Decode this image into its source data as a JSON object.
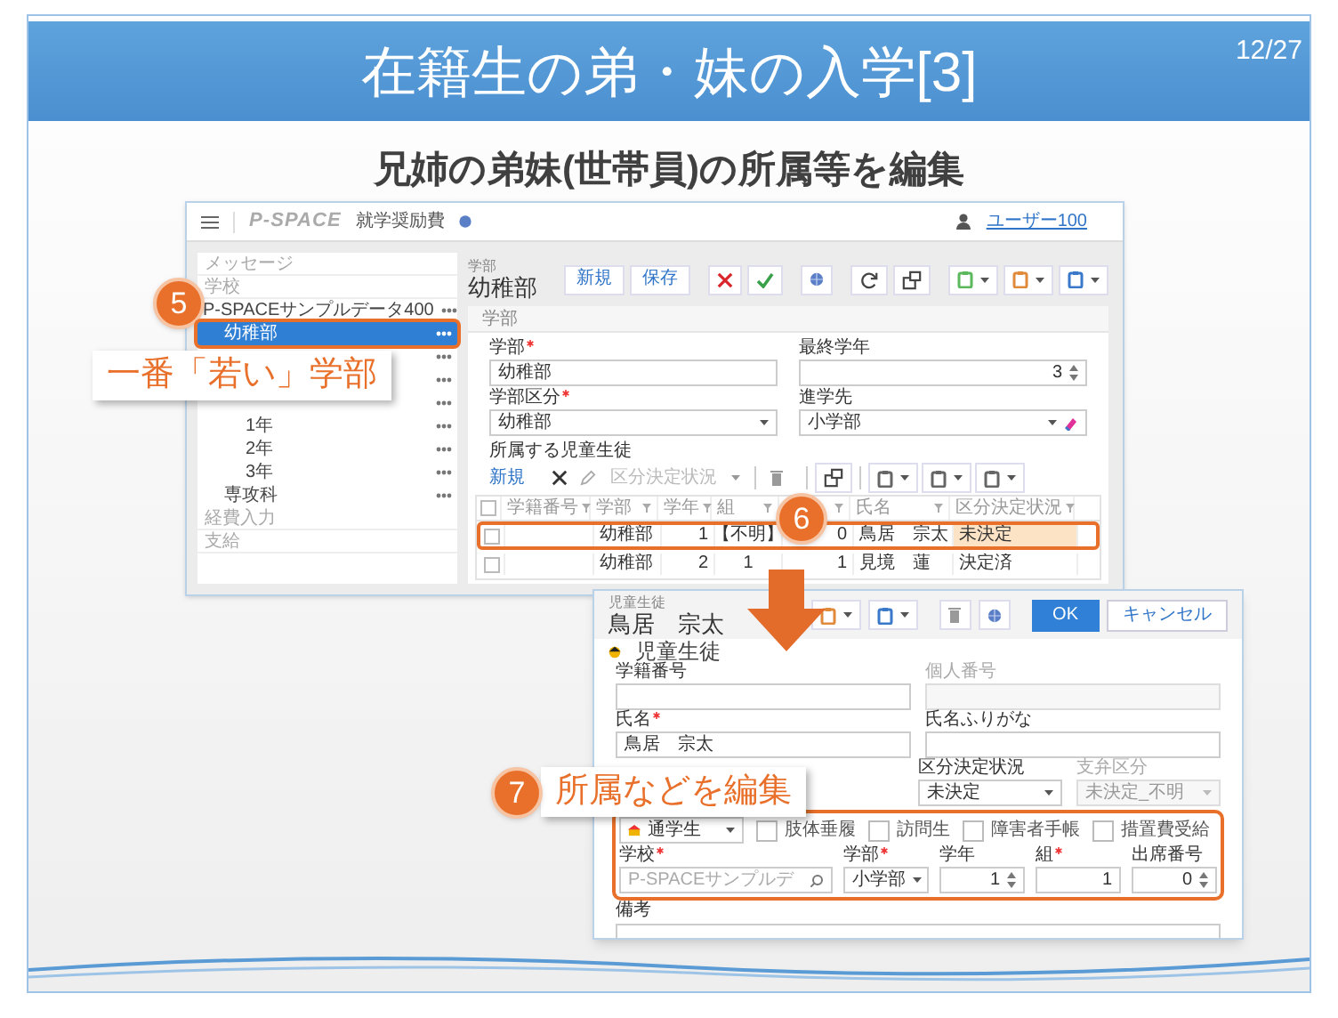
{
  "slide": {
    "title": "在籍生の弟・妹の入学[3]",
    "page": "12/27",
    "subtitle": "兄姉の弟妹(世帯員)の所属等を編集"
  },
  "school_screen": {
    "logo": "P-SPACE",
    "app_name": "就学奨励費",
    "user": "ユーザー100",
    "sidebar": [
      {
        "kind": "heading",
        "label": "メッセージ"
      },
      {
        "kind": "heading",
        "label": "学校"
      },
      {
        "kind": "tree",
        "label": "P-SPACEサンプルデータ400",
        "selected": false,
        "highlighted": false,
        "children": [
          {
            "label": "幼稚部",
            "selected": true,
            "highlighted": true
          },
          {
            "selected": false
          },
          {
            "selected": false
          },
          {
            "selected": false,
            "children": [
              {
                "label": "1年",
                "selected": false,
                "highlighted": false
              },
              {
                "label": "2年",
                "selected": false,
                "highlighted": false
              },
              {
                "label": "3年",
                "selected": false,
                "highlighted": false
              }
            ]
          },
          {
            "label": "専攻科",
            "selected": false,
            "highlighted": false
          }
        ]
      },
      {
        "kind": "heading",
        "label": "経費入力"
      },
      {
        "kind": "heading",
        "label": "支給"
      }
    ],
    "breadcrumb": "学部",
    "heading": "幼稚部",
    "toolbar": [
      {
        "kind": "text",
        "label": "新規"
      },
      {
        "kind": "text",
        "label": "保存"
      },
      {
        "kind": "gap"
      },
      {
        "kind": "delete"
      },
      {
        "kind": "confirm"
      },
      {
        "kind": "gap"
      },
      {
        "kind": "globe"
      },
      {
        "kind": "gap"
      },
      {
        "kind": "refresh"
      },
      {
        "kind": "window"
      },
      {
        "kind": "gap"
      },
      {
        "kind": "dropdown",
        "color": "#5cb85c"
      },
      {
        "kind": "dropdown",
        "color": "#e08a3c"
      },
      {
        "kind": "dropdown",
        "color": "#3a78c9"
      }
    ],
    "panel_title": "学部",
    "fields": [
      {
        "label": "学部",
        "required": true,
        "kind": "text",
        "value": "幼稚部"
      },
      {
        "label": "最終学年",
        "required": false,
        "kind": "number",
        "value": "3"
      },
      {
        "label": "学部区分",
        "required": true,
        "kind": "select",
        "value": "幼稚部"
      },
      {
        "label": "進学先",
        "required": false,
        "kind": "select_clear",
        "value": "小学部"
      }
    ],
    "students": {
      "label": "所属する児童生徒",
      "toolbar": [
        {
          "kind": "link",
          "label": "新規"
        },
        {
          "kind": "gap"
        },
        {
          "kind": "delete_plain"
        },
        {
          "kind": "pencil"
        },
        {
          "kind": "select",
          "label": "区分決定状況",
          "disabled": true
        },
        {
          "kind": "separator"
        },
        {
          "kind": "trash_plain"
        },
        {
          "kind": "gap"
        },
        {
          "kind": "separator"
        },
        {
          "kind": "window"
        },
        {
          "kind": "separator"
        },
        {
          "kind": "dropdown",
          "color": "#666666"
        },
        {
          "kind": "dropdown",
          "color": "#666666"
        },
        {
          "kind": "dropdown",
          "color": "#666666"
        }
      ],
      "select_all": {
        "checked": false
      },
      "columns": [
        {
          "label": "学籍番号"
        },
        {
          "label": "学部"
        },
        {
          "label": "学年"
        },
        {
          "label": "組"
        },
        {},
        {
          "label": "氏名"
        },
        {
          "label": "区分決定状況"
        }
      ],
      "rows": [
        {
          "checked": false,
          "highlighted": true,
          "cells": [
            "",
            "幼稚部",
            "1",
            "【不明】",
            "0",
            "鳥居　宗太",
            {
              "text": "未決定",
              "active": true
            }
          ]
        },
        {
          "checked": false,
          "highlighted": false,
          "cells": [
            "",
            "幼稚部",
            "2",
            "1",
            "1",
            "見境　蓮",
            {
              "text": "決定済",
              "active": false
            }
          ]
        }
      ]
    }
  },
  "student_screen": {
    "caption": "児童生徒",
    "name": "鳥居　宗太",
    "toolbar": [
      {
        "kind": "dropdown",
        "color": "#e08a3c"
      },
      {
        "kind": "dropdown",
        "color": "#3a78c9"
      },
      {
        "kind": "gap"
      },
      {
        "kind": "trash"
      },
      {
        "kind": "globe"
      },
      {
        "kind": "gap"
      },
      {
        "kind": "primary",
        "label": "OK"
      },
      {
        "kind": "secondary",
        "label": "キャンセル"
      }
    ],
    "section": "児童生徒",
    "rows": [
      [
        {
          "label": "学籍番号",
          "required": false,
          "kind": "text",
          "disabled": false
        },
        {
          "label": "個人番号",
          "required": false,
          "kind": "text",
          "disabled": true
        }
      ],
      [
        {
          "label": "氏名",
          "required": true,
          "kind": "text",
          "value": "鳥居　宗太",
          "disabled": false
        },
        {
          "label": "氏名ふりがな",
          "required": false,
          "kind": "text",
          "disabled": false
        }
      ],
      [
        {
          "kind": "hidden"
        },
        {
          "label": "区分決定状況",
          "required": false,
          "kind": "select",
          "value": "未決定",
          "disabled": false
        },
        {
          "label": "支弁区分",
          "required": false,
          "kind": "select",
          "value": "未決定_不明",
          "disabled": true
        }
      ]
    ],
    "status": {
      "value": "通学生"
    },
    "checkboxes": [
      {
        "label": "肢体垂履",
        "checked": false
      },
      {
        "label": "訪問生",
        "checked": false
      },
      {
        "label": "障害者手帳",
        "checked": false
      },
      {
        "label": "措置費受給",
        "checked": false
      }
    ],
    "placement": [
      {
        "label": "学校",
        "required": true,
        "kind": "search",
        "placeholder": "P-SPACEサンプルデ"
      },
      {
        "label": "学部",
        "required": true,
        "kind": "select",
        "value": "小学部"
      },
      {
        "label": "学年",
        "required": false,
        "kind": "number",
        "value": "1"
      },
      {
        "label": "組",
        "required": true,
        "kind": "text_right",
        "value": "1"
      },
      {
        "label": "出席番号",
        "required": false,
        "kind": "number",
        "value": "0"
      }
    ],
    "highlighted": true,
    "remarks_label": "備考"
  },
  "callouts": [
    {
      "number": "5",
      "label": "一番「若い」学部"
    },
    {
      "number": "6"
    },
    {
      "number": "7",
      "label": "所属などを編集"
    }
  ]
}
